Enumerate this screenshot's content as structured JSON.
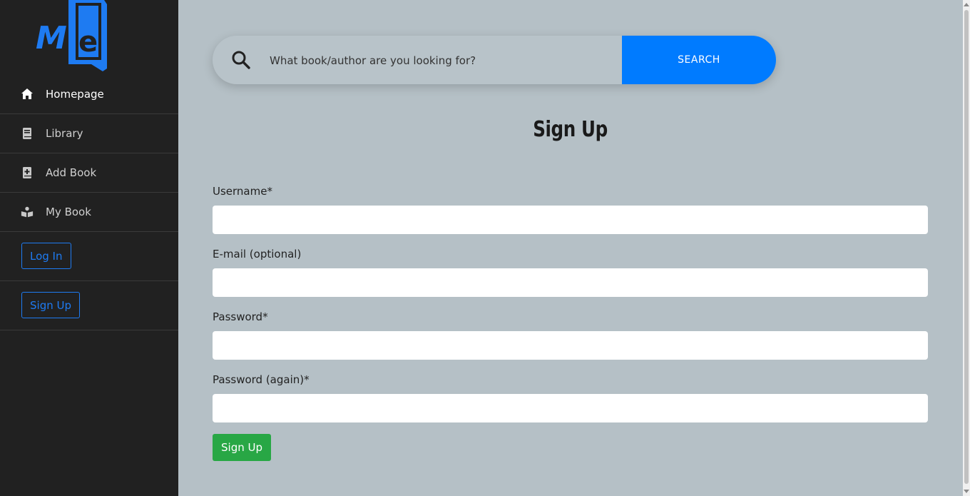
{
  "sidebar": {
    "logo_text": "Me",
    "items": [
      {
        "label": "Homepage",
        "icon": "home-icon"
      },
      {
        "label": "Library",
        "icon": "book-icon"
      },
      {
        "label": "Add Book",
        "icon": "add-book-icon"
      },
      {
        "label": "My Book",
        "icon": "reading-icon"
      }
    ],
    "login_label": "Log In",
    "signup_label": "Sign Up"
  },
  "search": {
    "placeholder": "What book/author are you looking for?",
    "button_label": "SEARCH"
  },
  "form": {
    "title": "Sign Up",
    "username_label": "Username*",
    "email_label": "E-mail (optional)",
    "password_label": "Password*",
    "password2_label": "Password (again)*",
    "submit_label": "Sign Up"
  },
  "colors": {
    "sidebar_bg": "#212121",
    "main_bg": "#b5c0c6",
    "accent": "#007bff",
    "submit": "#28a745"
  }
}
